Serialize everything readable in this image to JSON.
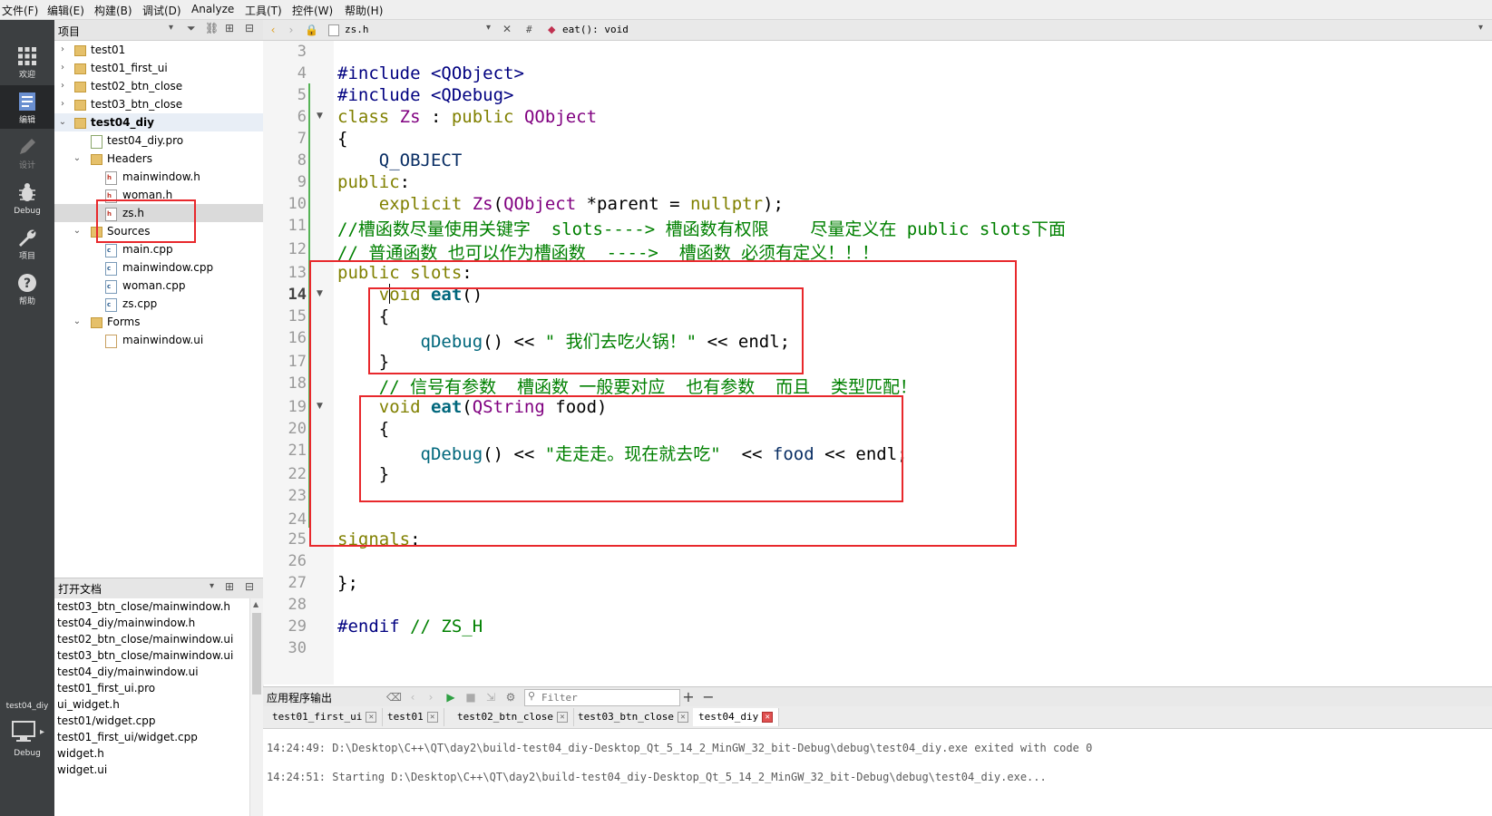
{
  "menu": [
    "文件(F)",
    "编辑(E)",
    "构建(B)",
    "调试(D)",
    "Analyze",
    "工具(T)",
    "控件(W)",
    "帮助(H)"
  ],
  "modes": [
    {
      "label": "欢迎",
      "icon": "grid-icon"
    },
    {
      "label": "编辑",
      "icon": "edit-doc-icon"
    },
    {
      "label": "设计",
      "icon": "pencil-icon"
    },
    {
      "label": "Debug",
      "icon": "bug-icon"
    },
    {
      "label": "项目",
      "icon": "wrench-icon"
    },
    {
      "label": "帮助",
      "icon": "help-icon"
    }
  ],
  "kit": {
    "project": "test04_diy",
    "mode": "Debug"
  },
  "tree_title": "项目",
  "tree": [
    {
      "name": "test01",
      "type": "project",
      "arrow": "›"
    },
    {
      "name": "test01_first_ui",
      "type": "project",
      "arrow": "›"
    },
    {
      "name": "test02_btn_close",
      "type": "project",
      "arrow": "›"
    },
    {
      "name": "test03_btn_close",
      "type": "project",
      "arrow": "›"
    },
    {
      "name": "test04_diy",
      "type": "project",
      "arrow": "⌄"
    },
    {
      "name": "test04_diy.pro",
      "type": "pro",
      "arrow": ""
    },
    {
      "name": "Headers",
      "type": "folder",
      "arrow": "⌄"
    },
    {
      "name": "mainwindow.h",
      "type": "h",
      "arrow": ""
    },
    {
      "name": "woman.h",
      "type": "h",
      "arrow": ""
    },
    {
      "name": "zs.h",
      "type": "h",
      "arrow": ""
    },
    {
      "name": "Sources",
      "type": "folder",
      "arrow": "⌄"
    },
    {
      "name": "main.cpp",
      "type": "cpp",
      "arrow": ""
    },
    {
      "name": "mainwindow.cpp",
      "type": "cpp",
      "arrow": ""
    },
    {
      "name": "woman.cpp",
      "type": "cpp",
      "arrow": ""
    },
    {
      "name": "zs.cpp",
      "type": "cpp",
      "arrow": ""
    },
    {
      "name": "Forms",
      "type": "folder",
      "arrow": "⌄"
    },
    {
      "name": "mainwindow.ui",
      "type": "ui",
      "arrow": ""
    }
  ],
  "open_docs_title": "打开文档",
  "open_docs": [
    "test03_btn_close/mainwindow.h",
    "test04_diy/mainwindow.h",
    "test02_btn_close/mainwindow.ui",
    "test03_btn_close/mainwindow.ui",
    "test04_diy/mainwindow.ui",
    "test01_first_ui.pro",
    "ui_widget.h",
    "test01/widget.cpp",
    "test01_first_ui/widget.cpp",
    "widget.h",
    "widget.ui"
  ],
  "editor": {
    "file": "zs.h",
    "symbol_hash": "#",
    "symbol": "eat(): void",
    "current_line": "14"
  },
  "line_numbers": [
    "3",
    "4",
    "5",
    "6",
    "7",
    "8",
    "9",
    "10",
    "11",
    "12",
    "13",
    "14",
    "15",
    "16",
    "17",
    "18",
    "19",
    "20",
    "21",
    "22",
    "23",
    "24",
    "25",
    "26",
    "27",
    "28",
    "29",
    "30"
  ],
  "code_text": {
    "l4_a": "#include ",
    "l4_b": "<QObject>",
    "l5_a": "#include ",
    "l5_b": "<QDebug>",
    "l6_a": "class ",
    "l6_b": "Zs",
    ":": " : ",
    "l6_c": "public ",
    "l6_d": "QObject",
    "l7": "{",
    "l8": "    Q_OBJECT",
    "l9_a": "public",
    "l9_b": ":",
    "l10_a": "    explicit ",
    "l10_b": "Zs",
    "l10_c": "(",
    "l10_d": "QObject",
    " l10_e": " *parent = ",
    "l10_f": "nullptr",
    "l10_g": ");",
    "l11": "//槽函数尽量使用关键字  slots----> 槽函数有权限    尽量定义在 public slots下面",
    "l12": "// 普通函数 也可以作为槽函数  ---->  槽函数 必须有定义！！！",
    "l13_a": "public slots",
    "l13_b": ":",
    "l14_a": "    void ",
    "l14_b": "eat",
    "l14_c": "()",
    "l15": "    {",
    "l16_a": "        ",
    "l16_b": "qDebug",
    "l16_c": "() << ",
    "l16_d": "\" 我们去吃火锅！\"",
    "l16_e": " << endl;",
    "l17": "    }",
    "l18": "    // 信号有参数  槽函数 一般要对应  也有参数  而且  类型匹配！",
    "l19_a": "    void ",
    "l19_b": "eat",
    "l19_c": "(",
    "l19_d": "QString",
    "l19_e": " food",
    ")": ")",
    "l20": "    {",
    "l21_a": "        ",
    "l21_b": "qDebug",
    "l21_c": "() << ",
    "l21_d": "\"走走走。现在就去吃\"",
    "l21_e": "  << ",
    "l21_f": "food",
    "l21_g": " << endl;",
    "l22": "    }",
    "l25_a": "signals",
    "l25_b": ":",
    "l27": "};",
    "l29_a": "#endif ",
    "l29_b": "// ZS_H"
  },
  "output": {
    "title": "应用程序输出",
    "filter_placeholder": "Filter",
    "tabs": [
      "test01_first_ui",
      "test01",
      "test02_btn_close",
      "test03_btn_close",
      "test04_diy"
    ],
    "lines": [
      "14:24:49: D:\\Desktop\\C++\\QT\\day2\\build-test04_diy-Desktop_Qt_5_14_2_MinGW_32_bit-Debug\\debug\\test04_diy.exe exited with code 0",
      "14:24:51: Starting D:\\Desktop\\C++\\QT\\day2\\build-test04_diy-Desktop_Qt_5_14_2_MinGW_32_bit-Debug\\debug\\test04_diy.exe..."
    ]
  },
  "colors": {
    "highlight_box": "#e8282c",
    "keyword": "#808000",
    "comment": "#008000",
    "preprocessor": "#000080",
    "type": "#800080"
  }
}
